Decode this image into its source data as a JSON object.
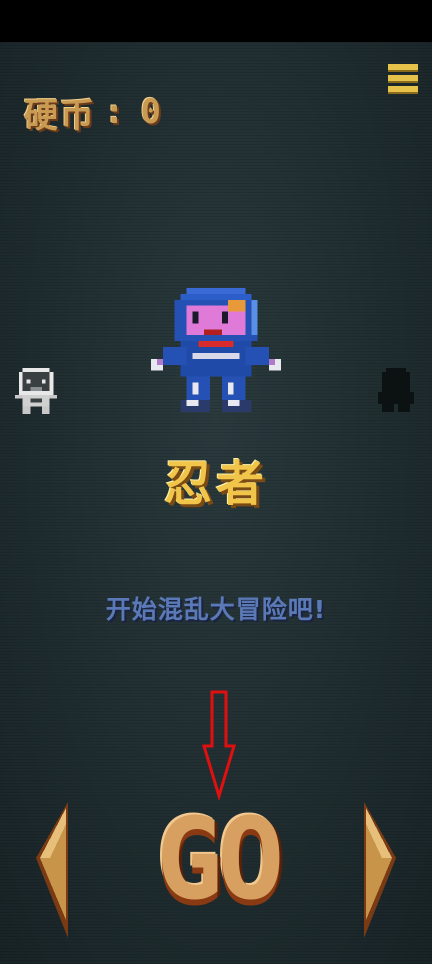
{
  "hud": {
    "coin_label": "硬币",
    "coin_separator": ":",
    "coin_value": "0"
  },
  "character": {
    "name": "忍者"
  },
  "tagline": "开始混乱大冒险吧!",
  "go_button": {
    "label": "GO"
  },
  "icons": {
    "menu": "hamburger-menu-icon",
    "left": "triangle-left-icon",
    "right": "triangle-right-icon",
    "annotation": "red-down-arrow"
  },
  "colors": {
    "gold": "#e6c24a",
    "title_gold": "#f0c54a",
    "tagline_blue": "#5a79b6",
    "go_orange": "#d7a060",
    "annotation_red": "#e01010"
  }
}
